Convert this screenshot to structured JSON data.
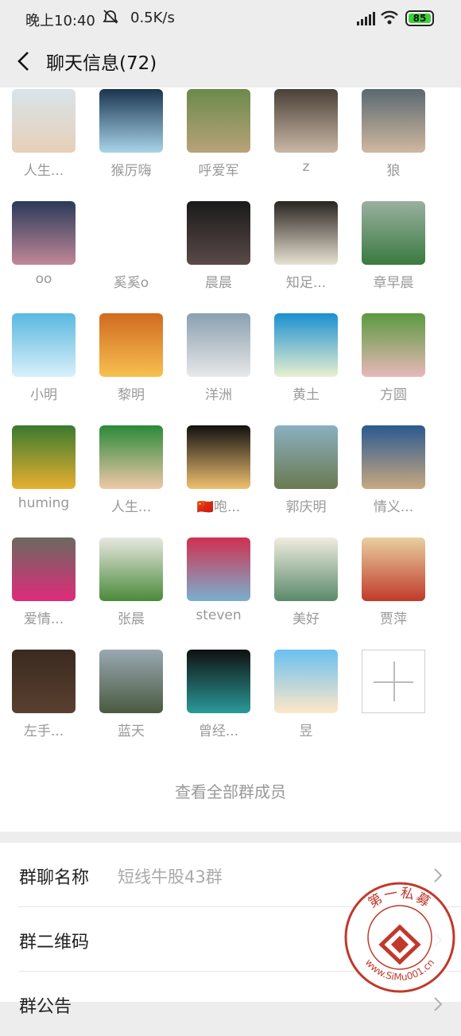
{
  "status_bar": {
    "time": "晚上10:40",
    "speed": "0.5K/s",
    "battery": "85"
  },
  "header": {
    "title": "聊天信息(72)"
  },
  "members": [
    {
      "name": "人生...",
      "colors": [
        "#d8e4ea",
        "#e8cfb8"
      ]
    },
    {
      "name": "猴厉嗨",
      "colors": [
        "#1a3550",
        "#a8d4e8"
      ]
    },
    {
      "name": "呼爱军",
      "colors": [
        "#6b8a4a",
        "#b9a27a"
      ]
    },
    {
      "name": "z",
      "colors": [
        "#4a4038",
        "#c9b8a6"
      ]
    },
    {
      "name": "狼",
      "colors": [
        "#5a6870",
        "#d0b8a0"
      ]
    },
    {
      "name": "oo",
      "colors": [
        "#2a3a5a",
        "#c08898"
      ]
    },
    {
      "name": "奚奚o",
      "colors": [
        "#ffffff",
        "#ffffff"
      ]
    },
    {
      "name": "晨晨",
      "colors": [
        "#1a1a1a",
        "#5a4a48"
      ]
    },
    {
      "name": "知足...",
      "colors": [
        "#2a2420",
        "#e8e2d4"
      ]
    },
    {
      "name": "章早晨",
      "colors": [
        "#9ab0a0",
        "#3a7a40"
      ]
    },
    {
      "name": "小明",
      "colors": [
        "#5ab8e0",
        "#d8f0fa"
      ]
    },
    {
      "name": "黎明",
      "colors": [
        "#d06a20",
        "#f8c050"
      ]
    },
    {
      "name": "洋洲",
      "colors": [
        "#8aa0b0",
        "#e8e8e8"
      ]
    },
    {
      "name": "黄土",
      "colors": [
        "#1a90d0",
        "#e8f0d0"
      ]
    },
    {
      "name": "方圆",
      "colors": [
        "#5a9a40",
        "#e8b8b8"
      ]
    },
    {
      "name": "huming",
      "colors": [
        "#3a7a30",
        "#e8b030"
      ]
    },
    {
      "name": "人生...",
      "colors": [
        "#2a8a3a",
        "#f0c8a8"
      ]
    },
    {
      "name": "🇨🇳咆...",
      "colors": [
        "#111111",
        "#f0c070"
      ]
    },
    {
      "name": "郭庆明",
      "colors": [
        "#8ab0c0",
        "#6a7a50"
      ]
    },
    {
      "name": "情义...",
      "colors": [
        "#2a5a90",
        "#c8a880"
      ]
    },
    {
      "name": "爱情...",
      "colors": [
        "#6a6a60",
        "#e02a7a"
      ]
    },
    {
      "name": "张晨",
      "colors": [
        "#e8e8e0",
        "#4a8a3a"
      ]
    },
    {
      "name": "steven",
      "colors": [
        "#d03050",
        "#7ab0d0"
      ]
    },
    {
      "name": "美好",
      "colors": [
        "#f0ece0",
        "#5a8a6a"
      ]
    },
    {
      "name": "贾萍",
      "colors": [
        "#e8d0a0",
        "#c03a2a"
      ]
    },
    {
      "name": "左手...",
      "colors": [
        "#3a2a20",
        "#5a4030"
      ]
    },
    {
      "name": "蓝天",
      "colors": [
        "#9aa8b0",
        "#4a5a40"
      ]
    },
    {
      "name": "曾经...",
      "colors": [
        "#101010",
        "#2a9a9a"
      ]
    },
    {
      "name": "昱",
      "colors": [
        "#6ac0f0",
        "#ffe8c8"
      ]
    }
  ],
  "add_member_icon": "plus-icon",
  "view_all": "查看全部群成员",
  "settings": [
    {
      "label": "群聊名称",
      "value": "短线牛股43群"
    },
    {
      "label": "群二维码",
      "value": ""
    },
    {
      "label": "群公告",
      "value": ""
    }
  ],
  "watermark": {
    "text_top": "第 一 私 募",
    "text_bottom": "www.SiMu001.cn",
    "color": "#c0392b"
  }
}
